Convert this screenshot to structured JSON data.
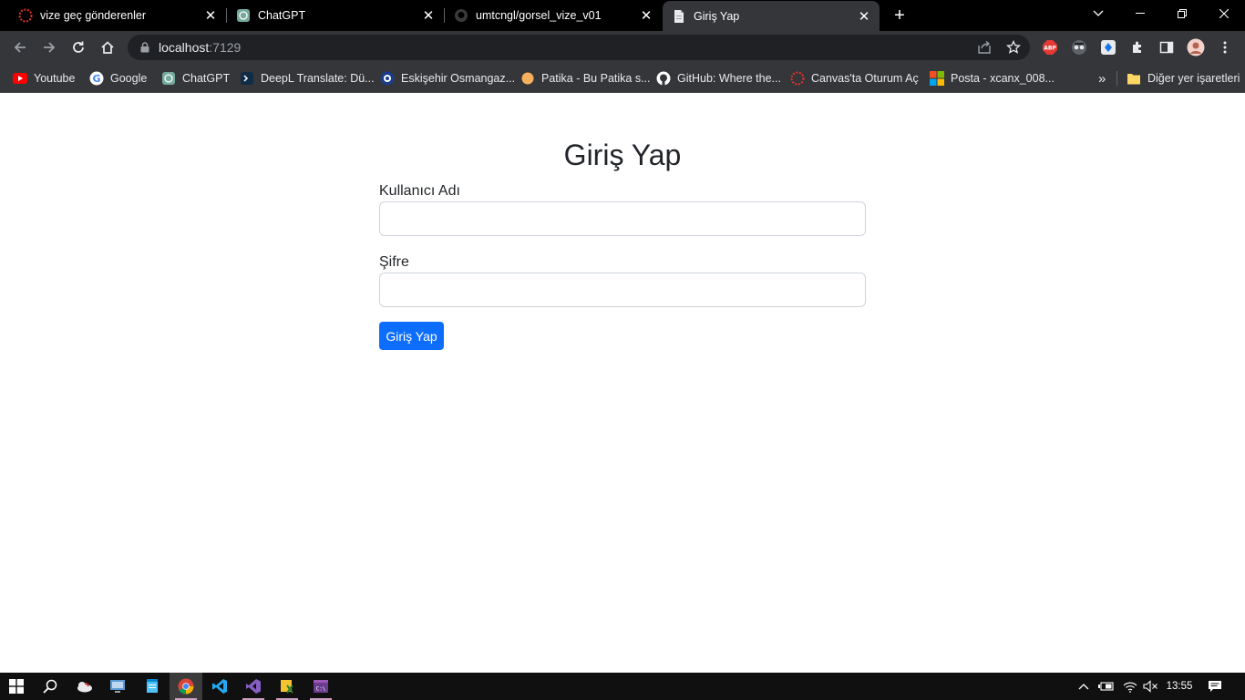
{
  "browser": {
    "tabs": [
      {
        "title": "vize geç gönderenler",
        "icon": "canvas-icon"
      },
      {
        "title": "ChatGPT",
        "icon": "chatgpt-icon"
      },
      {
        "title": "umtcngl/gorsel_vize_v01",
        "icon": "github-icon"
      },
      {
        "title": "Giriş Yap",
        "icon": "page-icon",
        "active": true
      }
    ],
    "address": {
      "host": "localhost",
      "port": ":7129"
    },
    "bookmarks": [
      {
        "label": "Youtube",
        "icon": "youtube-icon"
      },
      {
        "label": "Google",
        "icon": "google-icon"
      },
      {
        "label": "ChatGPT",
        "icon": "chatgpt-icon"
      },
      {
        "label": "DeepL Translate: Dü...",
        "icon": "deepl-icon"
      },
      {
        "label": "Eskişehir Osmangaz...",
        "icon": "university-icon"
      },
      {
        "label": "Patika - Bu Patika s...",
        "icon": "patika-icon"
      },
      {
        "label": "GitHub: Where the...",
        "icon": "github-icon"
      },
      {
        "label": "Canvas'ta Oturum Aç",
        "icon": "canvas-icon"
      },
      {
        "label": "Posta - xcanx_008...",
        "icon": "microsoft-icon"
      }
    ],
    "bookmarks_overflow": "»",
    "other_bookmarks": "Diğer yer işaretleri",
    "extensions": {
      "abp": "ABP"
    }
  },
  "page": {
    "title": "Giriş Yap",
    "username_label": "Kullanıcı Adı",
    "username_value": "",
    "password_label": "Şifre",
    "password_value": "",
    "submit_label": "Giriş Yap",
    "accent_color": "#0d6efd"
  },
  "taskbar": {
    "clock": "13:55"
  }
}
